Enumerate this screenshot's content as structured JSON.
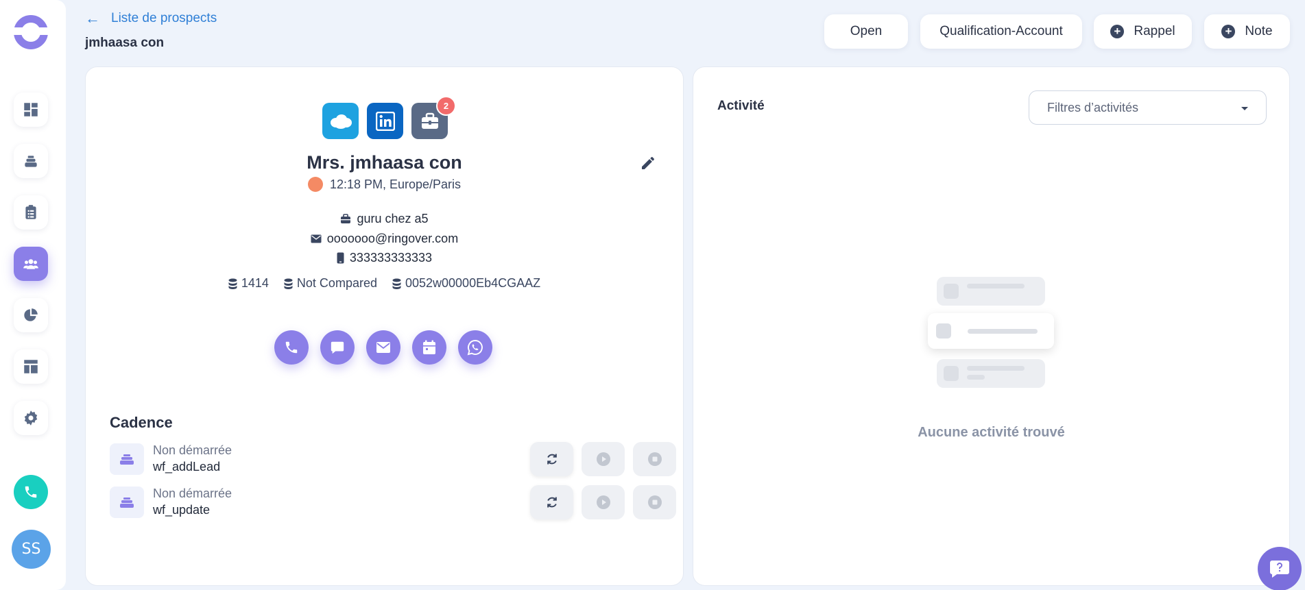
{
  "header": {
    "back_label": "Liste de prospects",
    "page_title": "jmhaasa con",
    "buttons": {
      "open": "Open",
      "qualification": "Qualification-Account",
      "rappel": "Rappel",
      "note": "Note"
    }
  },
  "sidebar": {
    "items": [
      {
        "icon": "dashboard-icon"
      },
      {
        "icon": "stack-icon"
      },
      {
        "icon": "clipboard-icon"
      },
      {
        "icon": "people-icon",
        "active": true
      },
      {
        "icon": "pie-chart-icon"
      },
      {
        "icon": "layout-icon"
      },
      {
        "icon": "gear-icon"
      }
    ],
    "avatar_initials": "SS"
  },
  "contact": {
    "badge_count": "2",
    "name": "Mrs. jmhaasa con",
    "timezone": "12:18 PM, Europe/Paris",
    "job": "guru chez a5",
    "email": "ooooooo@ringover.com",
    "phone": "333333333333",
    "ids": [
      "1414",
      "Not Compared",
      "0052w00000Eb4CGAAZ"
    ]
  },
  "cadence": {
    "title": "Cadence",
    "rows": [
      {
        "status": "Non démarrée",
        "name": "wf_addLead"
      },
      {
        "status": "Non démarrée",
        "name": "wf_update"
      }
    ]
  },
  "activity": {
    "title": "Activité",
    "filter_placeholder": "Filtres d’activités",
    "empty_text": "Aucune activité trouvé"
  },
  "colors": {
    "accent": "#8b7fe8",
    "link": "#2f7fd6",
    "teal": "#19cfc0",
    "badge": "#f26b6b"
  }
}
